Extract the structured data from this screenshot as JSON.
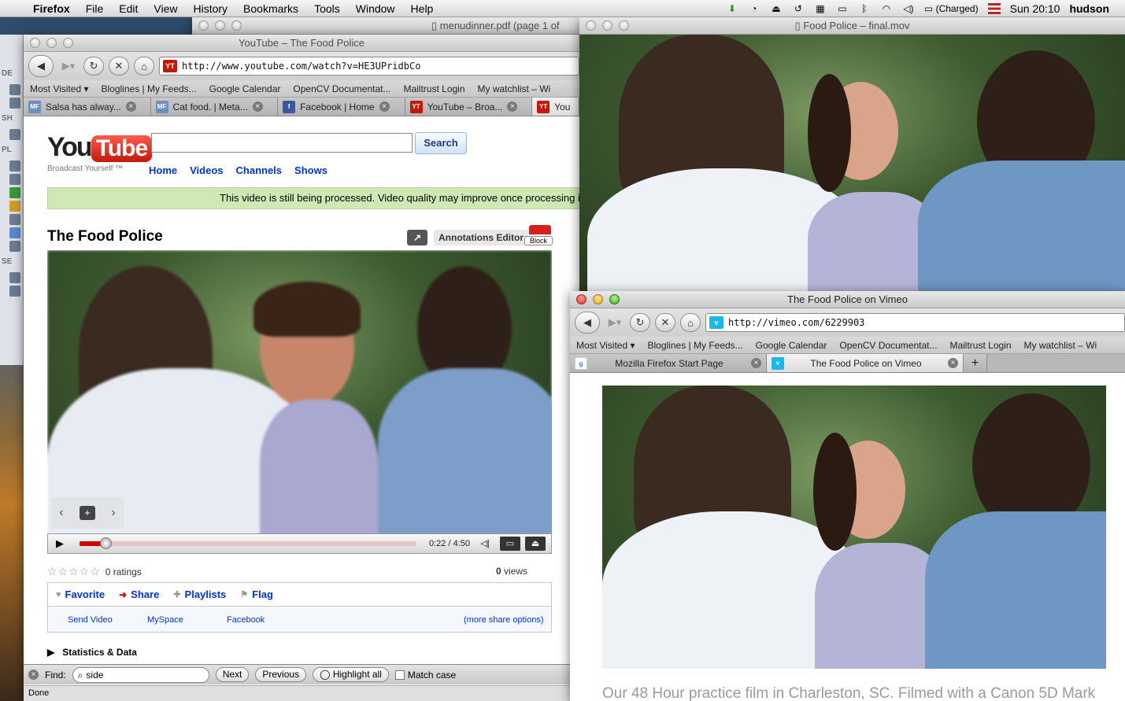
{
  "menubar": {
    "app": "Firefox",
    "items": [
      "File",
      "Edit",
      "View",
      "History",
      "Bookmarks",
      "Tools",
      "Window",
      "Help"
    ],
    "battery": "(Charged)",
    "clock": "Sun 20:10",
    "user": "hudson"
  },
  "finder": {
    "sections": [
      "DE",
      "SH",
      "PL",
      "SE"
    ]
  },
  "pdf_window": {
    "title": "menudinner.pdf (page 1 of"
  },
  "youtube_window": {
    "title": "YouTube – The Food Police",
    "url": "http://www.youtube.com/watch?v=HE3UPridbCo",
    "bookmarks": [
      "Most Visited ▾",
      "Bloglines | My Feeds...",
      "Google Calendar",
      "OpenCV Documentat...",
      "Mailtrust Login",
      "My watchlist – Wi"
    ],
    "tabs": [
      "Salsa has alway...",
      "Cat food. | Meta...",
      "Facebook | Home",
      "YouTube – Broa...",
      "You"
    ],
    "page": {
      "logo_you": "You",
      "logo_tube": "Tube",
      "tagline": "Broadcast Yourself ™",
      "search_button": "Search",
      "nav": [
        "Home",
        "Videos",
        "Channels",
        "Shows"
      ],
      "processing_notice": "This video is still being processed. Video quality may improve once processing i",
      "video_title": "The Food Police",
      "annotations_editor": "Annotations Editor",
      "block_label": "Block",
      "time": "0:22 / 4:50",
      "progress_fraction": 0.076,
      "ratings": "0 ratings",
      "views_count": "0",
      "views_label": "views",
      "actions": [
        "Favorite",
        "Share",
        "Playlists",
        "Flag"
      ],
      "share_links": [
        "Send Video",
        "MySpace",
        "Facebook",
        "(more share options)"
      ],
      "stats_label": "Statistics & Data"
    },
    "findbar": {
      "label": "Find:",
      "query": "side",
      "next": "Next",
      "previous": "Previous",
      "highlight": "Highlight all",
      "match_case": "Match case"
    },
    "status": "Done"
  },
  "quicktime_window": {
    "title": "Food Police – final.mov"
  },
  "vimeo_window": {
    "title": "The Food Police on Vimeo",
    "url": "http://vimeo.com/6229903",
    "bookmarks": [
      "Most Visited ▾",
      "Bloglines | My Feeds...",
      "Google Calendar",
      "OpenCV Documentat...",
      "Mailtrust Login",
      "My watchlist – Wi"
    ],
    "tabs": [
      "Mozilla Firefox Start Page",
      "The Food Police on Vimeo"
    ],
    "description": "Our 48 Hour practice film in Charleston, SC. Filmed with a Canon 5D Mark"
  },
  "colors": {
    "youtube_red": "#d10000",
    "link_blue": "#0033cc",
    "notice_green": "#cfe9b4",
    "vimeo_blue": "#1ab7ea"
  }
}
